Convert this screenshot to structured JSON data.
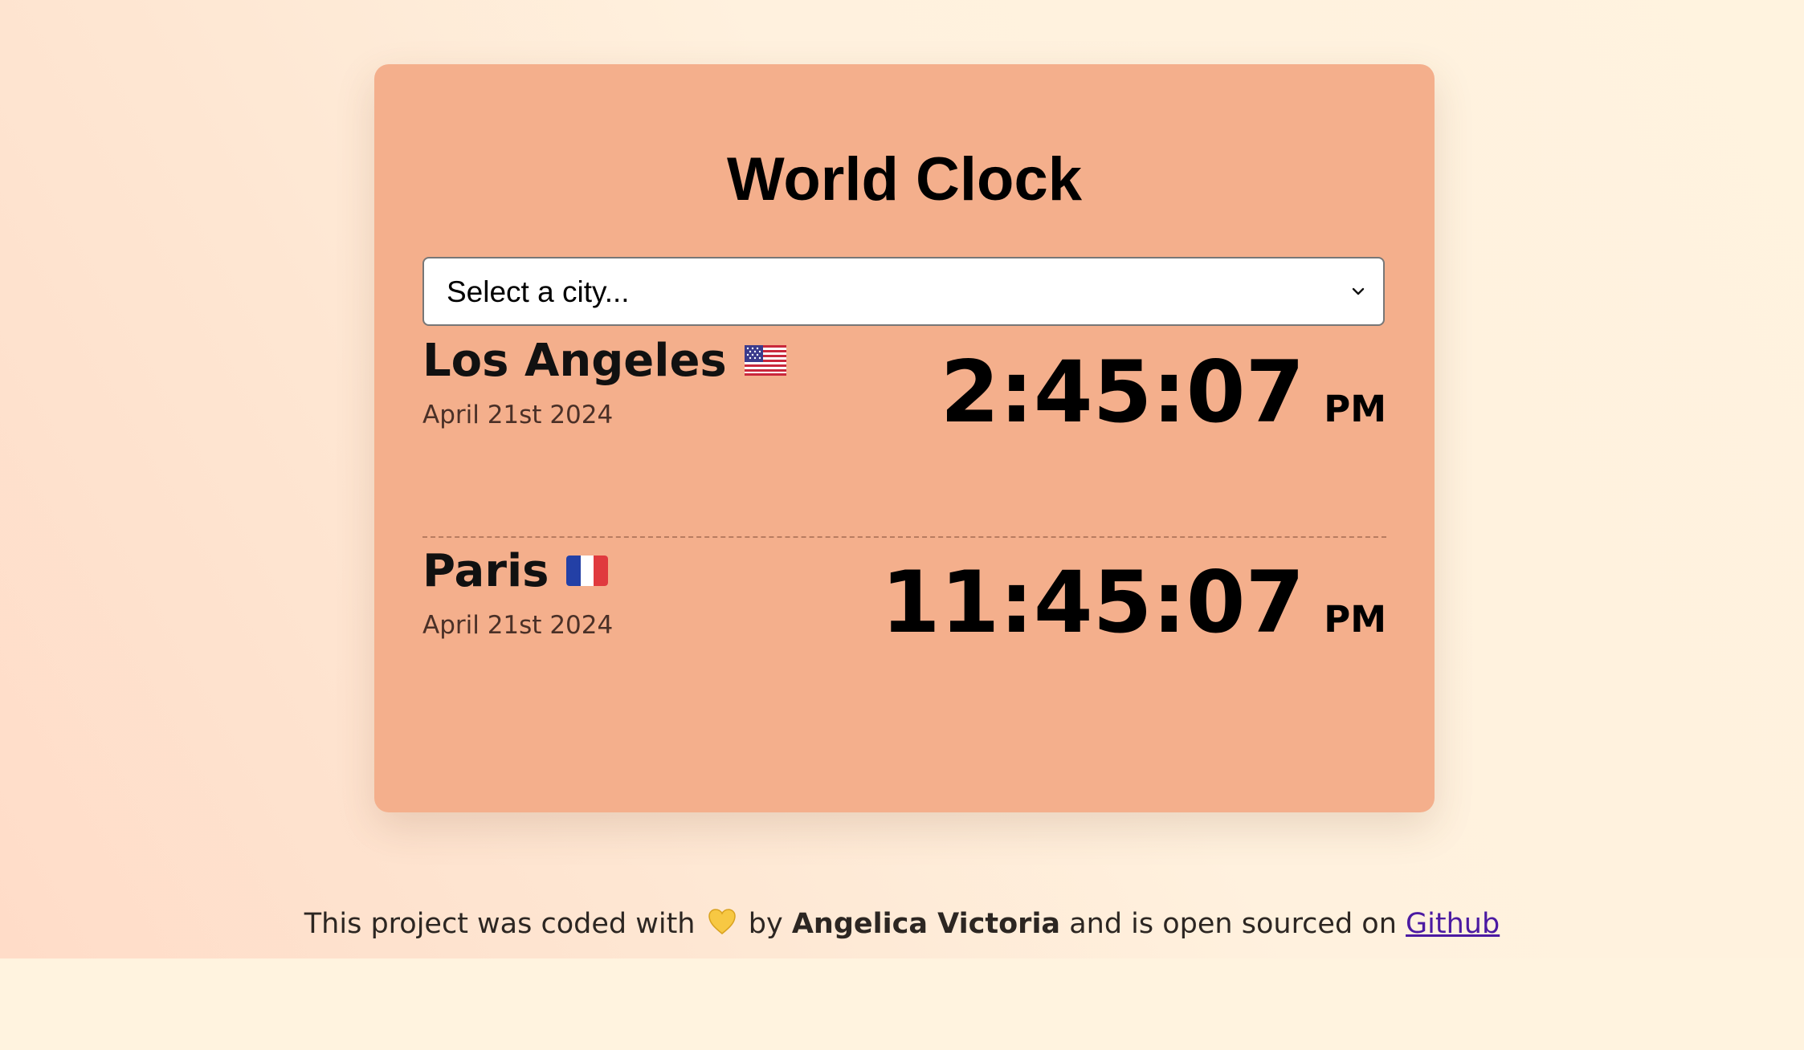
{
  "app": {
    "title": "World Clock"
  },
  "city_select": {
    "selected_label": "Select a city..."
  },
  "cities": [
    {
      "name": "Los Angeles",
      "flag_icon": "us-flag-icon",
      "date": "April 21st 2024",
      "time": "2:45:07",
      "ampm": "PM"
    },
    {
      "name": "Paris",
      "flag_icon": "france-flag-icon",
      "date": "April 21st 2024",
      "time": "11:45:07",
      "ampm": "PM"
    }
  ],
  "footer": {
    "text_before": "This project was coded with",
    "heart_icon": "yellow-heart-icon",
    "text_by": "by",
    "author": "Angelica Victoria",
    "text_after": "and is open sourced on",
    "link_label": "Github"
  },
  "colors": {
    "page_background": "#fff3df",
    "card_background": "#f4af8c",
    "link": "#4b1aa2"
  }
}
